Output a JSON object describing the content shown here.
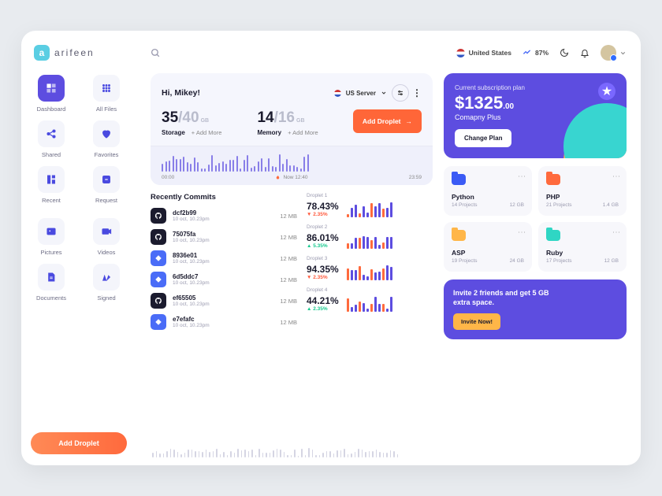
{
  "brand": "arifeen",
  "topbar": {
    "region": "United States",
    "metric_value": "87%",
    "moon": "moon",
    "bell": "bell"
  },
  "nav": [
    {
      "label": "Dashboard",
      "icon": "grid",
      "active": true
    },
    {
      "label": "All Files",
      "icon": "apps",
      "active": false
    },
    {
      "label": "Shared",
      "icon": "share",
      "active": false
    },
    {
      "label": "Favorites",
      "icon": "heart",
      "active": false
    },
    {
      "label": "Recent",
      "icon": "recent",
      "active": false
    },
    {
      "label": "Request",
      "icon": "request",
      "active": false
    },
    {
      "label": "Pictures",
      "icon": "image",
      "active": false
    },
    {
      "label": "Videos",
      "icon": "video",
      "active": false
    },
    {
      "label": "Documents",
      "icon": "doc",
      "active": false
    },
    {
      "label": "Signed",
      "icon": "sign",
      "active": false
    }
  ],
  "add_droplet": "Add Droplet",
  "hero": {
    "greeting": "Hi, Mikey!",
    "server": "US Server",
    "storage": {
      "used": "35",
      "max": "/40",
      "unit": "GB",
      "label": "Storage",
      "add": "+ Add More"
    },
    "memory": {
      "used": "14",
      "max": "/16",
      "unit": "GB",
      "label": "Memory",
      "add": "+ Add More"
    },
    "cta": "Add Droplet",
    "tl_start": "00:00",
    "tl_now": "Now 12:40",
    "tl_end": "23:59"
  },
  "commits_title": "Recently Commits",
  "commits": [
    {
      "hash": "dcf2b99",
      "date": "10 oct, 10.23pm",
      "size": "12 MB",
      "ico": "gh"
    },
    {
      "hash": "75075fa",
      "date": "10 oct, 10.23pm",
      "size": "12 MB",
      "ico": "gh"
    },
    {
      "hash": "8936e01",
      "date": "10 oct, 10.23pm",
      "size": "12 MB",
      "ico": "bb"
    },
    {
      "hash": "6d5ddc7",
      "date": "10 oct, 10.23pm",
      "size": "12 MB",
      "ico": "bb"
    },
    {
      "hash": "ef65505",
      "date": "10 oct, 10.23pm",
      "size": "12 MB",
      "ico": "gh"
    },
    {
      "hash": "e7efafc",
      "date": "10 oct, 10.23pm",
      "size": "12 MB",
      "ico": "bb"
    }
  ],
  "droplets": [
    {
      "name": "Droplet 1",
      "pct": "78.43%",
      "delta": "▼ 2.35%",
      "dir": "dn"
    },
    {
      "name": "Droplet 2",
      "pct": "86.01%",
      "delta": "▲ 5.35%",
      "dir": "up"
    },
    {
      "name": "Droplet 3",
      "pct": "94.35%",
      "delta": "▼ 2.35%",
      "dir": "dn"
    },
    {
      "name": "Droplet 4",
      "pct": "44.21%",
      "delta": "▲ 2.35%",
      "dir": "up"
    }
  ],
  "subscription": {
    "title": "Current subscription plan",
    "price": "$1325",
    "cents": ".00",
    "plan": "Comapny Plus",
    "cta": "Change Plan"
  },
  "folders": [
    {
      "name": "Python",
      "projects": "14 Projects",
      "size": "12 GB",
      "color": "fc-blue"
    },
    {
      "name": "PHP",
      "projects": "21 Projects",
      "size": "1.4 GB",
      "color": "fc-orange"
    },
    {
      "name": "ASP",
      "projects": "19 Projects",
      "size": "24 GB",
      "color": "fc-yellow"
    },
    {
      "name": "Ruby",
      "projects": "17 Projects",
      "size": "12 GB",
      "color": "fc-teal"
    }
  ],
  "invite": {
    "text": "Invite 2 friends and get 5 GB extra space.",
    "cta": "Invite Now!"
  }
}
